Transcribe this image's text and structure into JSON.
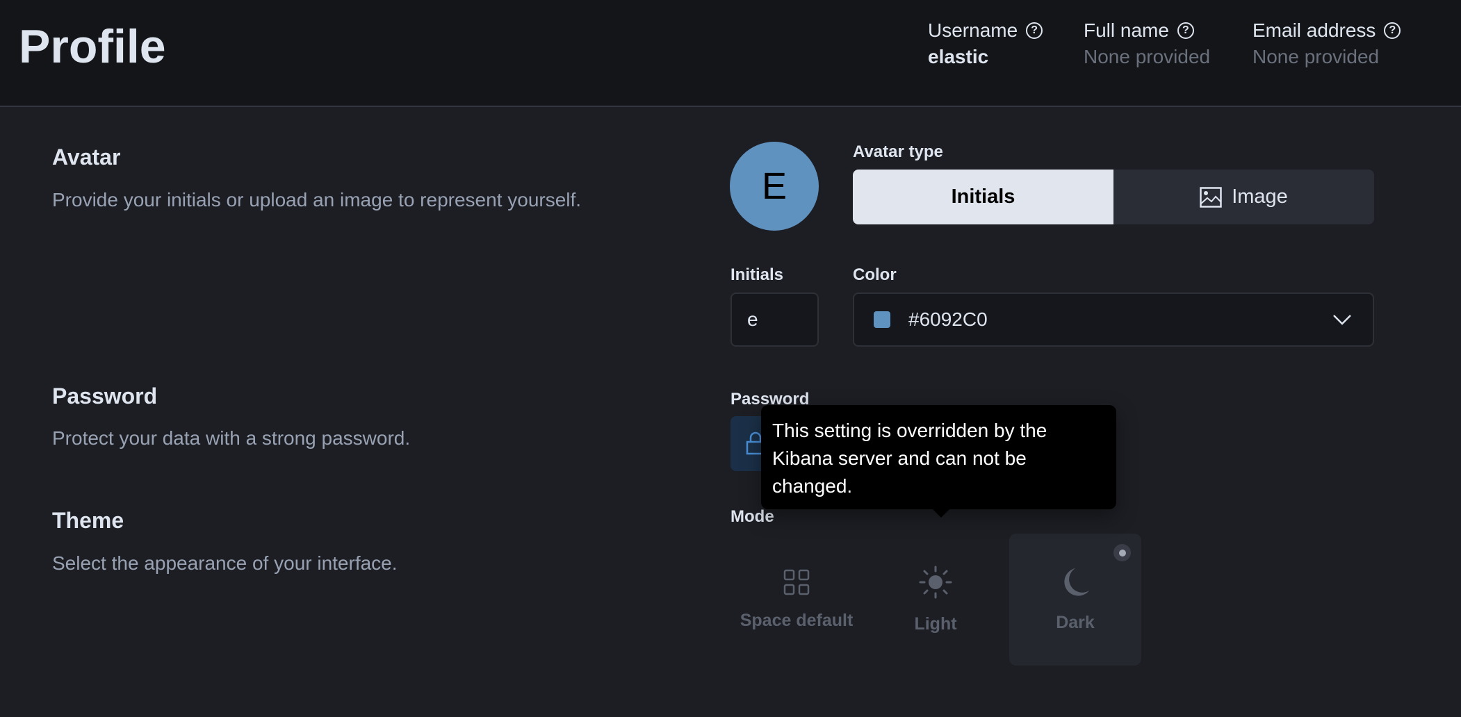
{
  "header": {
    "title": "Profile",
    "fields": [
      {
        "label": "Username",
        "value": "elastic"
      },
      {
        "label": "Full name",
        "value": "None provided"
      },
      {
        "label": "Email address",
        "value": "None provided"
      }
    ]
  },
  "sections": {
    "avatar": {
      "title": "Avatar",
      "description": "Provide your initials or upload an image to represent yourself."
    },
    "password": {
      "title": "Password",
      "description": "Protect your data with a strong password."
    },
    "theme": {
      "title": "Theme",
      "description": "Select the appearance of your interface."
    }
  },
  "avatar": {
    "initial_display": "E",
    "color": "#6092C0",
    "type_label": "Avatar type",
    "types": [
      "Initials",
      "Image"
    ],
    "selected_type": "Initials",
    "initials_label": "Initials",
    "initials_value": "e",
    "color_label": "Color",
    "color_value": "#6092C0"
  },
  "password": {
    "label": "Password"
  },
  "tooltip": {
    "text": "This setting is overridden by the Kibana server and can not be changed."
  },
  "mode": {
    "label": "Mode",
    "options": [
      {
        "label": "Space default",
        "icon": "grid-icon"
      },
      {
        "label": "Light",
        "icon": "sun-icon"
      },
      {
        "label": "Dark",
        "icon": "moon-icon"
      }
    ],
    "selected": "Dark"
  }
}
